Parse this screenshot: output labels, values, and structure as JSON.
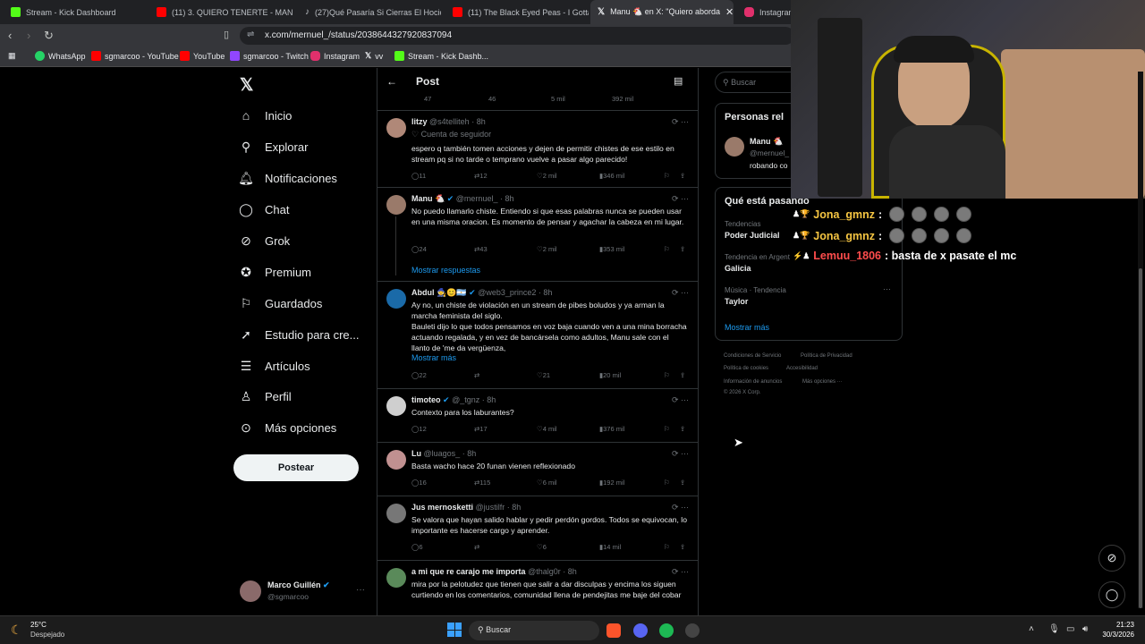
{
  "browser": {
    "tabs": [
      {
        "label": "Stream - Kick Dashboard",
        "color": "#53fc18"
      },
      {
        "label": "(11) 3. QUIERO TENERTE - MANU W",
        "color": "#ff0000"
      },
      {
        "label": "(27)Qué Pasaría Si Cierras El Hocico",
        "color": "#ffffff"
      },
      {
        "label": "(11) The Black Eyed Peas - I Gotta Fe",
        "color": "#ff0000"
      },
      {
        "label": "Manu 🐔 en X: \"Quiero aborda",
        "color": "#ffffff"
      },
      {
        "label": "Instagram",
        "color": "#e1306c"
      }
    ],
    "url": "x.com/mernuel_/status/2038644327920837094",
    "bookmarks": [
      "WhatsApp",
      "sgmarcoo - YouTube",
      "YouTube",
      "sgmarcoo - Twitch",
      "Instagram",
      "vv",
      "Stream - Kick Dashb..."
    ]
  },
  "nav": {
    "items": [
      "Inicio",
      "Explorar",
      "Notificaciones",
      "Chat",
      "Grok",
      "Premium",
      "Guardados",
      "Estudio para cre...",
      "Artículos",
      "Perfil",
      "Más opciones"
    ],
    "post_button": "Postear",
    "profile_name": "Marco Guillén",
    "profile_handle": "@sgmarcoo"
  },
  "header": {
    "title": "Post"
  },
  "top_counts": {
    "replies": "47",
    "reposts": "46",
    "likes": "5 mil",
    "views": "392 mil"
  },
  "tweets": [
    {
      "name": "litzy",
      "handle": "@s4telliteh",
      "time": "· 8h",
      "badge": "Cuenta de seguidor",
      "text": "espero q también tomen acciones y dejen de permitir chistes de ese estilo en stream pq si no tarde o temprano vuelve a pasar algo parecido!",
      "replies": "11",
      "reposts": "12",
      "likes": "2 mil",
      "views": "346 mil"
    },
    {
      "name": "Manu 🐔",
      "handle": "@mernuel_",
      "time": "· 8h",
      "text": "No puedo llamarlo chiste. Entiendo si que esas palabras nunca se pueden usar en una misma oracion. Es momento de pensar y agachar la cabeza en mi lugar.",
      "replies": "24",
      "reposts": "43",
      "likes": "2 mil",
      "views": "353 mil",
      "show_replies": "Mostrar respuestas"
    },
    {
      "name": "Abdul 🧙😊🇦🇷",
      "handle": "@web3_prince2",
      "time": "· 8h",
      "text": "Ay no, un chiste de violación en un stream de pibes boludos y ya arman la marcha feminista del siglo.\nBauleti dijo lo que todos pensamos en voz baja cuando ven a una mina borracha actuando regalada, y en vez de bancársela como adultos, Manu sale con el llanto de 'me da vergüenza,",
      "show_more": "Mostrar más",
      "replies": "22",
      "reposts": "",
      "likes": "21",
      "views": "20 mil"
    },
    {
      "name": "timoteo",
      "handle": "@_tgnz",
      "time": "· 8h",
      "text": "Contexto para los laburantes?",
      "replies": "12",
      "reposts": "17",
      "likes": "4 mil",
      "views": "376 mil"
    },
    {
      "name": "Lu",
      "handle": "@luagos_",
      "time": "· 8h",
      "text": "Basta wacho hace 20 funan vienen reflexionado",
      "replies": "16",
      "reposts": "115",
      "likes": "6 mil",
      "views": "192 mil"
    },
    {
      "name": "Jus mernosketti",
      "handle": "@justilfr",
      "time": "· 8h",
      "text": "Se valora que hayan salido hablar y pedir perdón gordos. Todos se equivocan, lo importante es hacerse cargo y aprender.",
      "replies": "6",
      "reposts": "",
      "likes": "6",
      "views": "14 mil"
    },
    {
      "name": "a mi que re carajo me importa",
      "handle": "@thalg0r",
      "time": "· 8h",
      "text": "mira por la pelotudez que tienen que salir a dar disculpas y encima los siguen curtiendo en los comentarios, comunidad llena de pendejitas me baje del cobar"
    }
  ],
  "right": {
    "search_placeholder": "Buscar",
    "people_title": "Personas rel",
    "person_name": "Manu 🐔",
    "person_handle": "@mernuel_",
    "person_bio": "robando co",
    "trends_title": "Qué está pasando",
    "trends": [
      {
        "context": "Tendencias",
        "name": "Poder Judicial"
      },
      {
        "context": "Tendencia en Argent",
        "name": "Galicia"
      },
      {
        "context": "Música · Tendencia",
        "name": "Taylor"
      }
    ],
    "show_more": "Mostrar más",
    "footer": [
      "Condiciones de Servicio",
      "Política de Privacidad",
      "Política de cookies",
      "Accesibilidad",
      "Información de anuncios",
      "Más opciones ···",
      "© 2026 X Corp."
    ]
  },
  "chat_overlay": [
    {
      "user": "Jona_gmnz",
      "color": "#f5c542",
      "message": ":"
    },
    {
      "user": "Jona_gmnz",
      "color": "#f5c542",
      "message": ":"
    },
    {
      "user": "Lemuu_1806",
      "color": "#ff4d4d",
      "message": ": basta de x pasate el mc"
    }
  ],
  "taskbar": {
    "weather_temp": "25°C",
    "weather_desc": "Despejado",
    "search": "Buscar",
    "time": "21:23",
    "date": "30/3/2026"
  },
  "colors": {
    "accent": "#1d9bf0",
    "verified": "#1d9bf0",
    "background": "#000000"
  }
}
